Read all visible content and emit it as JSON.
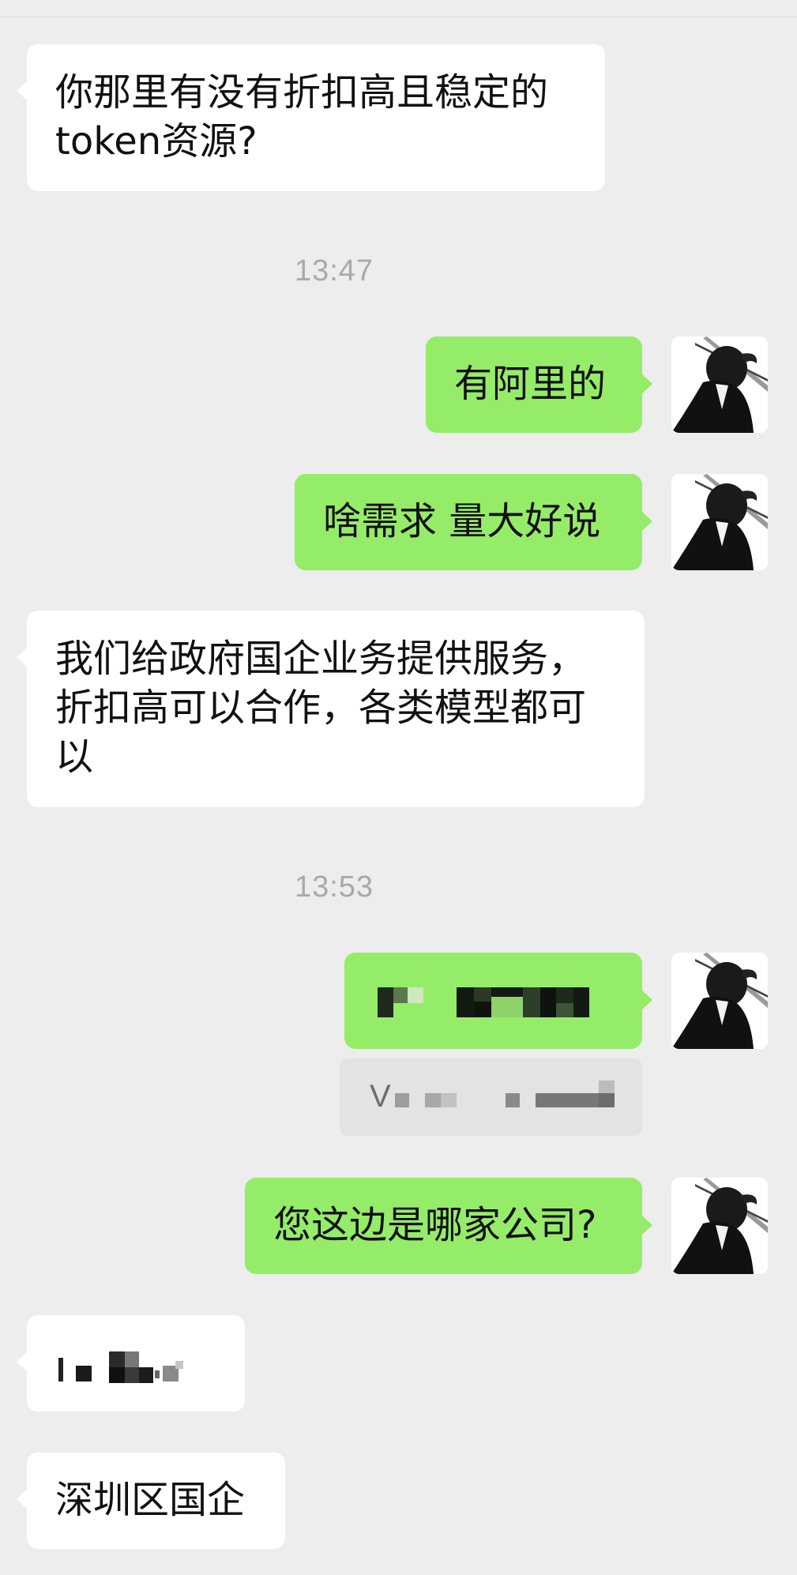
{
  "chat": {
    "messages": {
      "m1": {
        "text": "你那里有没有折扣高且稳定的token资源?",
        "side": "received"
      },
      "t1": {
        "text": "13:47"
      },
      "m2": {
        "text": "有阿里的",
        "side": "sent"
      },
      "m3": {
        "text": "啥需求 量大好说",
        "side": "sent"
      },
      "m4": {
        "text": "我们给政府国企业务提供服务，折扣高可以合作，各类模型都可以",
        "side": "received"
      },
      "t2": {
        "text": "13:53"
      },
      "m5": {
        "side": "sent",
        "content": "pixelated-redacted"
      },
      "m5_quote": {
        "prefix": "V",
        "content": "pixelated-redacted"
      },
      "m6": {
        "text": "您这边是哪家公司?",
        "side": "sent"
      },
      "m7": {
        "side": "received",
        "content": "pixelated-redacted"
      },
      "m8": {
        "text": "深圳区国企",
        "side": "received"
      }
    }
  },
  "colors": {
    "background": "#ededed",
    "sent_bubble": "#95ec69",
    "received_bubble": "#ffffff",
    "timestamp": "#a9a9a9",
    "quote_bg": "#e3e3e3"
  },
  "icons": {
    "avatar": "avatar-silhouette-with-sword"
  }
}
